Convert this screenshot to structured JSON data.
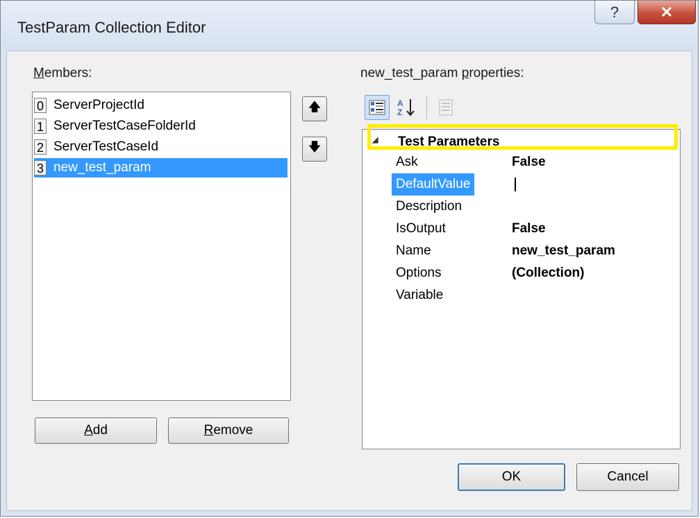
{
  "window": {
    "title": "TestParam Collection Editor",
    "help_glyph": "?",
    "close_glyph": "✕"
  },
  "members": {
    "label_prefix": "",
    "label_underlined": "M",
    "label_rest": "embers:",
    "items": [
      {
        "index": "0",
        "name": "ServerProjectId",
        "selected": false
      },
      {
        "index": "1",
        "name": "ServerTestCaseFolderId",
        "selected": false
      },
      {
        "index": "2",
        "name": "ServerTestCaseId",
        "selected": false
      },
      {
        "index": "3",
        "name": "new_test_param",
        "selected": true
      }
    ],
    "add_underlined": "A",
    "add_rest": "dd",
    "remove_underlined": "R",
    "remove_rest": "emove",
    "move_up_glyph": "🡅",
    "move_down_glyph": "🡇"
  },
  "properties": {
    "label_prefix": "new_test_param ",
    "label_underlined": "p",
    "label_rest": "roperties:",
    "category_glyph": "◢",
    "category": "Test Parameters",
    "rows": [
      {
        "name": "Ask",
        "value": "False"
      },
      {
        "name": "DefaultValue",
        "value": ""
      },
      {
        "name": "Description",
        "value": ""
      },
      {
        "name": "IsOutput",
        "value": "False"
      },
      {
        "name": "Name",
        "value": "new_test_param"
      },
      {
        "name": "Options",
        "value": "(Collection)"
      },
      {
        "name": "Variable",
        "value": ""
      }
    ],
    "highlight_color": "#ffee00",
    "selected_color": "#3399ff"
  },
  "footer": {
    "ok_label": "OK",
    "cancel_label": "Cancel"
  }
}
